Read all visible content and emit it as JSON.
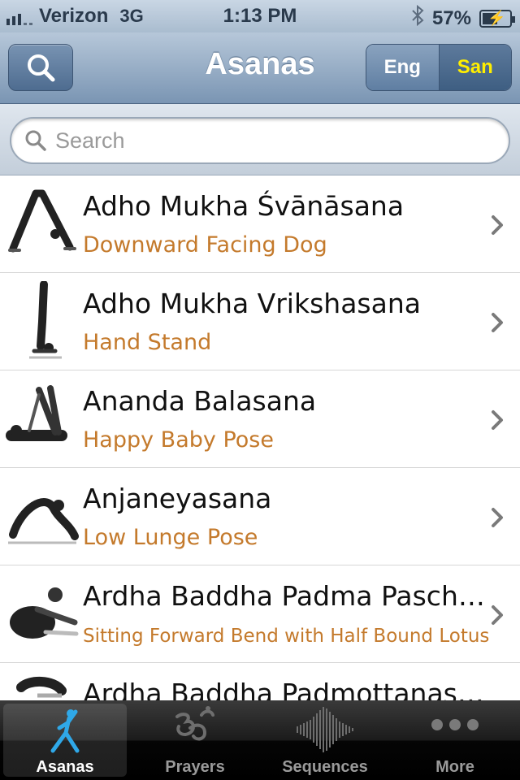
{
  "status_bar": {
    "carrier": "Verizon",
    "network": "3G",
    "time": "1:13 PM",
    "battery": "57%",
    "battery_level": 0.57
  },
  "nav": {
    "title": "Asanas",
    "segments": {
      "eng": "Eng",
      "san": "San",
      "selected": "San"
    }
  },
  "search": {
    "placeholder": "Search",
    "value": ""
  },
  "asanas": [
    {
      "name": "Adho Mukha Śvānāsana",
      "english": "Downward Facing Dog"
    },
    {
      "name": "Adho Mukha Vrikshasana",
      "english": "Hand Stand"
    },
    {
      "name": "Ananda Balasana",
      "english": "Happy Baby Pose"
    },
    {
      "name": "Anjaneyasana",
      "english": "Low Lunge Pose"
    },
    {
      "name": "Ardha Baddha Padma Paschimottanasana",
      "english": "Sitting Forward Bend with Half Bound Lotus"
    },
    {
      "name": "Ardha Baddha Padmottanasana",
      "english": ""
    }
  ],
  "tabs": [
    {
      "label": "Asanas",
      "icon": "yoga-figure-icon",
      "active": true
    },
    {
      "label": "Prayers",
      "icon": "om-icon",
      "active": false
    },
    {
      "label": "Sequences",
      "icon": "waveform-icon",
      "active": false
    },
    {
      "label": "More",
      "icon": "more-dots-icon",
      "active": false
    }
  ],
  "colors": {
    "subtitle": "#c47a2c",
    "segment_selected_text": "#ffee00",
    "tab_active_icon": "#2fa8e8"
  }
}
